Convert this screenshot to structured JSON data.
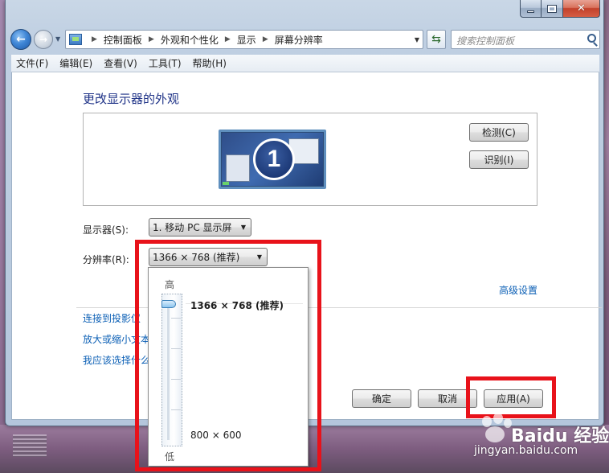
{
  "address": {
    "crumbs": [
      "控制面板",
      "外观和个性化",
      "显示",
      "屏幕分辨率"
    ],
    "search_placeholder": "搜索控制面板"
  },
  "menu": [
    "文件(F)",
    "编辑(E)",
    "查看(V)",
    "工具(T)",
    "帮助(H)"
  ],
  "page": {
    "title": "更改显示器的外观",
    "monitor_number": "1",
    "detect_button": "检测(C)",
    "identify_button": "识别(I)",
    "display_label": "显示器(S):",
    "display_value": "1. 移动 PC 显示屏",
    "resolution_label": "分辨率(R):",
    "resolution_value": "1366 × 768 (推荐)",
    "advanced_link": "高级设置",
    "links": [
      "连接到投影仪",
      "放大或缩小文本",
      "我应该选择什么"
    ]
  },
  "flyout": {
    "high_label": "高",
    "low_label": "低",
    "top_value": "1366 × 768 (推荐)",
    "bottom_value": "800 × 600",
    "slider_level": 1.0
  },
  "footer": {
    "ok_button": "确定",
    "cancel_button": "取消",
    "apply_button": "应用(A)"
  },
  "watermark": {
    "brand": "Baidu 经验",
    "url": "jingyan.baidu.com"
  },
  "colors": {
    "title": "#1e3287",
    "link": "#0b5fb5",
    "annotation": "#e8121a"
  }
}
